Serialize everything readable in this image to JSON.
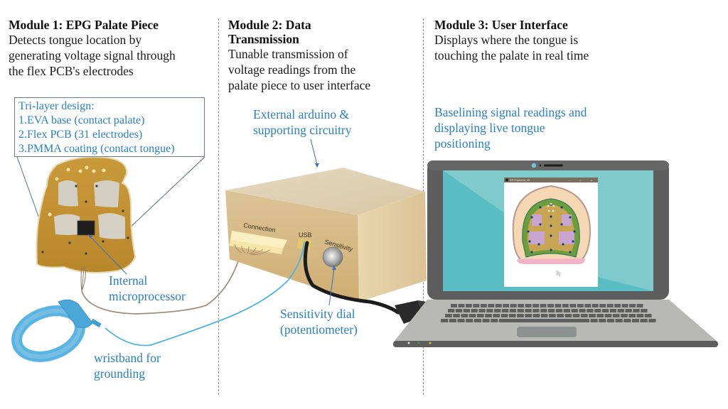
{
  "modules": [
    {
      "title": "Module 1: EPG Palate Piece",
      "description_lines": [
        "Detects tongue location by",
        "generating voltage signal through",
        "the flex PCB's electrodes"
      ]
    },
    {
      "title_lines": [
        "Module 2: Data",
        "Transmission"
      ],
      "description_lines": [
        "Tunable transmission of",
        "voltage readings from the",
        "palate piece to user interface"
      ]
    },
    {
      "title": "Module 3: User Interface",
      "description_lines": [
        "Displays where the tongue is",
        "touching the palate in real time"
      ]
    }
  ],
  "tri_layer": {
    "heading": "Tri-layer design:",
    "items": [
      "1.EVA base (contact palate)",
      "2.Flex PCB (31 electrodes)",
      "3.PMMA coating (contact tongue)"
    ]
  },
  "callouts": {
    "microprocessor": [
      "Internal",
      "microprocessor"
    ],
    "wristband": [
      "wristband for",
      "grounding"
    ],
    "arduino": [
      "External arduino &",
      "supporting circuitry"
    ],
    "sensitivity_dial": [
      "Sensitivity dial",
      "(potentiometer)"
    ],
    "baselining": [
      "Baselining signal readings and",
      "displaying live tongue",
      "positioning"
    ]
  },
  "box_labels": {
    "connection": "Connection",
    "usb": "USB",
    "sensitivity": "Sensitivity"
  },
  "screen_window": {
    "title": "EPCSpeech_v5",
    "controls": [
      "–",
      "□",
      "×"
    ]
  },
  "colors": {
    "callout_blue": "#2a7fc1",
    "wristband_blue": "#4db3e0",
    "box_tan": "#d8bf8e",
    "laptop_screen": "#5bbdc4",
    "laptop_bezel": "#5d5d5d",
    "laptop_base": "#b8b8b4"
  }
}
